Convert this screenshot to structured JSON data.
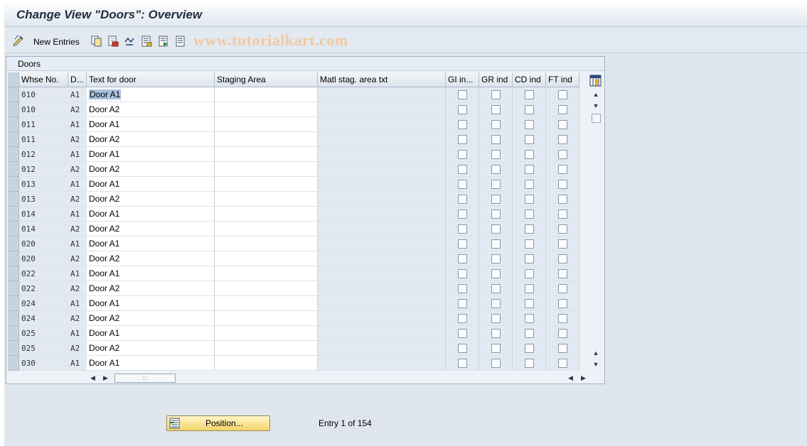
{
  "window": {
    "title": "Change View \"Doors\": Overview"
  },
  "toolbar": {
    "new_entries_label": "New Entries",
    "watermark": "www.tutorialkart.com",
    "icons": [
      "change-display-icon",
      "copy-icon",
      "delete-icon",
      "undo-icon",
      "select-all-icon",
      "select-block-icon",
      "deselect-all-icon"
    ]
  },
  "panel": {
    "title": "Doors"
  },
  "table": {
    "columns": [
      "Whse No.",
      "D...",
      "Text for door",
      "Staging Area",
      "Matl stag. area txt",
      "GI in...",
      "GR ind",
      "CD ind",
      "FT ind"
    ],
    "rows": [
      {
        "whse": "010",
        "door": "A1",
        "text": "Door A1"
      },
      {
        "whse": "010",
        "door": "A2",
        "text": "Door A2"
      },
      {
        "whse": "011",
        "door": "A1",
        "text": "Door A1"
      },
      {
        "whse": "011",
        "door": "A2",
        "text": "Door A2"
      },
      {
        "whse": "012",
        "door": "A1",
        "text": "Door A1"
      },
      {
        "whse": "012",
        "door": "A2",
        "text": "Door A2"
      },
      {
        "whse": "013",
        "door": "A1",
        "text": "Door A1"
      },
      {
        "whse": "013",
        "door": "A2",
        "text": "Door A2"
      },
      {
        "whse": "014",
        "door": "A1",
        "text": "Door A1"
      },
      {
        "whse": "014",
        "door": "A2",
        "text": "Door A2"
      },
      {
        "whse": "020",
        "door": "A1",
        "text": "Door A1"
      },
      {
        "whse": "020",
        "door": "A2",
        "text": "Door A2"
      },
      {
        "whse": "022",
        "door": "A1",
        "text": "Door A1"
      },
      {
        "whse": "022",
        "door": "A2",
        "text": "Door A2"
      },
      {
        "whse": "024",
        "door": "A1",
        "text": "Door A1"
      },
      {
        "whse": "024",
        "door": "A2",
        "text": "Door A2"
      },
      {
        "whse": "025",
        "door": "A1",
        "text": "Door A1"
      },
      {
        "whse": "025",
        "door": "A2",
        "text": "Door A2"
      },
      {
        "whse": "030",
        "door": "A1",
        "text": "Door A1"
      }
    ]
  },
  "footer": {
    "position_button": "Position...",
    "entry_info": "Entry 1 of 154"
  }
}
